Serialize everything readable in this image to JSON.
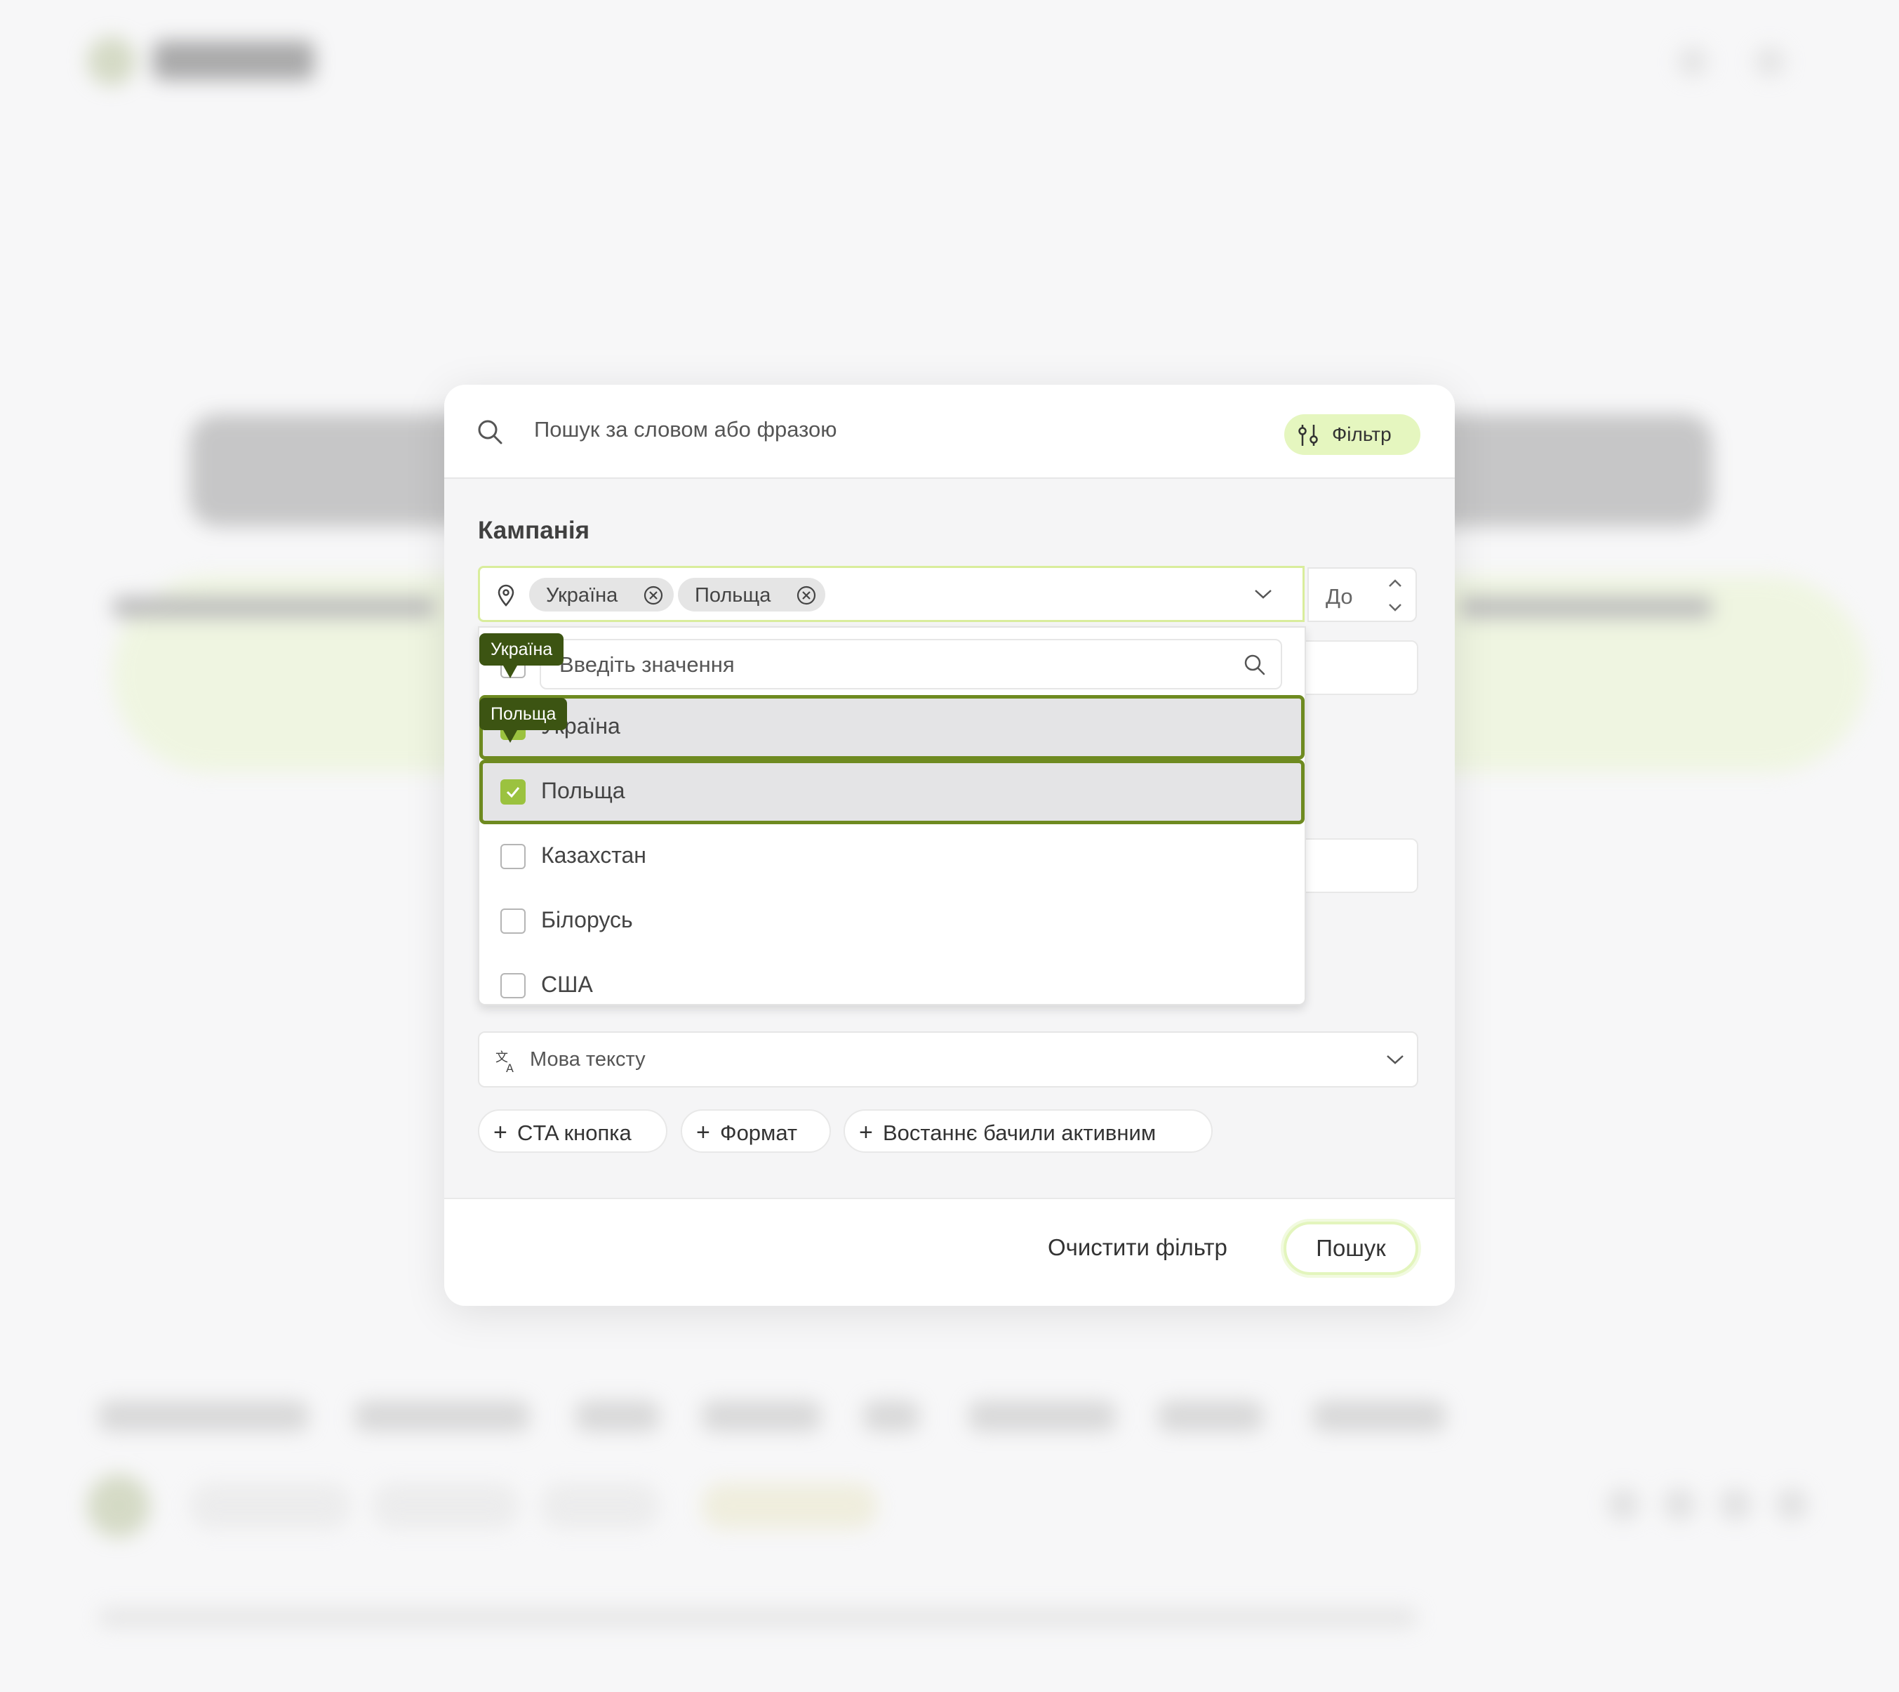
{
  "search": {
    "placeholder": "Пошук за словом або фразою"
  },
  "filter_button": {
    "label": "Фільтр"
  },
  "section": {
    "title": "Кампанія"
  },
  "countries": {
    "selected_chips": [
      "Україна",
      "Польща"
    ],
    "dropdown_search_placeholder": "Введіть значення",
    "options": [
      {
        "label": "Україна",
        "checked": true
      },
      {
        "label": "Польща",
        "checked": true
      },
      {
        "label": "Казахстан",
        "checked": false
      },
      {
        "label": "Білорусь",
        "checked": false
      },
      {
        "label": "США",
        "checked": false
      }
    ],
    "tooltips": [
      "Україна",
      "Польща"
    ]
  },
  "range": {
    "to_label": "До"
  },
  "language": {
    "placeholder": "Мова тексту"
  },
  "add_filters": [
    {
      "label": "CTA кнопка"
    },
    {
      "label": "Формат"
    },
    {
      "label": "Востаннє бачили активним"
    }
  ],
  "footer": {
    "clear_label": "Очистити фільтр",
    "submit_label": "Пошук"
  },
  "colors": {
    "accent_light": "#e5f6bf",
    "accent_dark": "#3c5412",
    "check": "#9bc23f",
    "selected_border": "#6e8a20"
  }
}
